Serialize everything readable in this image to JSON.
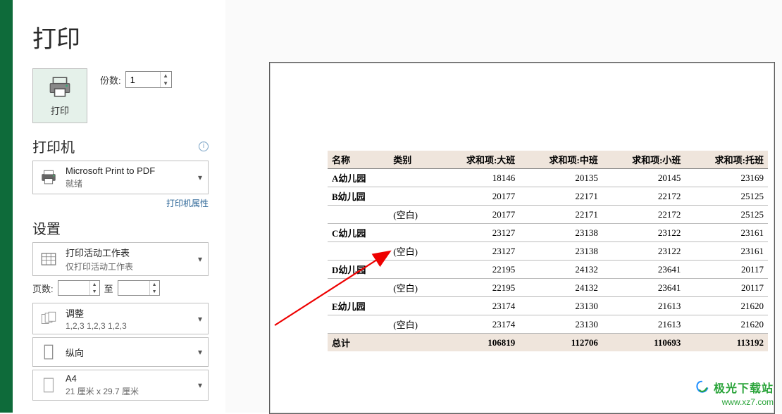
{
  "page_title": "打印",
  "print_button_label": "打印",
  "copies": {
    "label": "份数:",
    "value": "1"
  },
  "printer": {
    "header": "打印机",
    "name": "Microsoft Print to PDF",
    "status": "就绪",
    "props_link": "打印机属性"
  },
  "settings": {
    "header": "设置",
    "active_sheet": {
      "l1": "打印活动工作表",
      "l2": "仅打印活动工作表"
    },
    "pages": {
      "label": "页数:",
      "to": "至"
    },
    "collate": {
      "l1": "调整",
      "l2": "1,2,3   1,2,3   1,2,3"
    },
    "orientation": {
      "l1": "纵向"
    },
    "paper": {
      "l1": "A4",
      "l2": "21 厘米 x 29.7 厘米"
    }
  },
  "watermark": {
    "title": "极光下载站",
    "url": "www.xz7.com"
  },
  "chart_data": {
    "type": "table",
    "headers": [
      "名称",
      "类别",
      "求和项:大班",
      "求和项:中班",
      "求和项:小班",
      "求和项:托班"
    ],
    "rows": [
      {
        "name": "A幼儿园",
        "cat": "",
        "v": [
          18146,
          20135,
          20145,
          23169
        ]
      },
      {
        "name": "B幼儿园",
        "cat": "",
        "v": [
          20177,
          22171,
          22172,
          25125
        ]
      },
      {
        "name": "",
        "cat": "(空白)",
        "v": [
          20177,
          22171,
          22172,
          25125
        ]
      },
      {
        "name": "C幼儿园",
        "cat": "",
        "v": [
          23127,
          23138,
          23122,
          23161
        ]
      },
      {
        "name": "",
        "cat": "(空白)",
        "v": [
          23127,
          23138,
          23122,
          23161
        ]
      },
      {
        "name": "D幼儿园",
        "cat": "",
        "v": [
          22195,
          24132,
          23641,
          20117
        ]
      },
      {
        "name": "",
        "cat": "(空白)",
        "v": [
          22195,
          24132,
          23641,
          20117
        ]
      },
      {
        "name": "E幼儿园",
        "cat": "",
        "v": [
          23174,
          23130,
          21613,
          21620
        ]
      },
      {
        "name": "",
        "cat": "(空白)",
        "v": [
          23174,
          23130,
          21613,
          21620
        ]
      }
    ],
    "total": {
      "label": "总计",
      "v": [
        106819,
        112706,
        110693,
        113192
      ]
    }
  }
}
